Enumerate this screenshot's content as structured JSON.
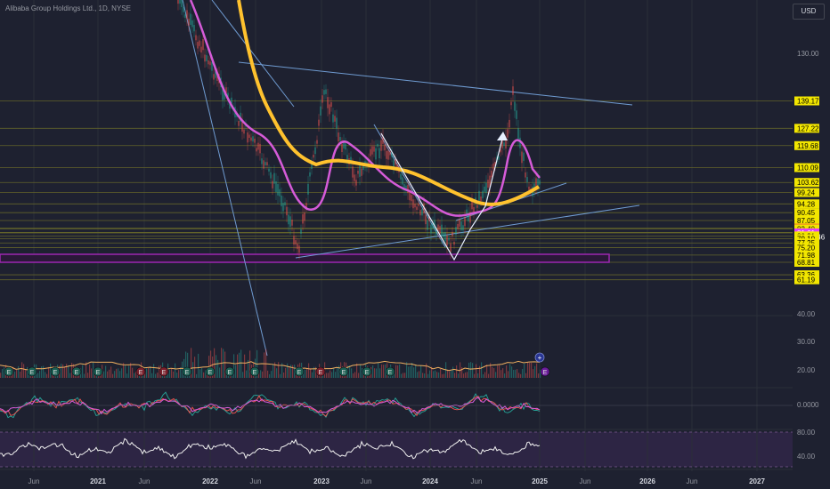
{
  "header": {
    "title": "Alibaba Group Holdings Ltd., 1D, NYSE",
    "currency": "USD"
  },
  "colors": {
    "background": "#1e2130",
    "price_tag_yellow": "#f2e600",
    "price_tag_red": "#f23645",
    "price_tag_magenta": "#e040fb",
    "ma_slow": "#ffc22e",
    "ma_fast": "#d55bd8",
    "trendline": "#6f9bd1",
    "support_zone": "#9c27b0",
    "hline": "#6a6a2a"
  },
  "price_axis": {
    "plain_labels": [
      "130.00",
      "40.00"
    ],
    "tags": [
      {
        "text": "139.17",
        "kind": "yellow"
      },
      {
        "text": "127.22",
        "kind": "yellow"
      },
      {
        "text": "119.68",
        "kind": "yellow"
      },
      {
        "text": "110.09",
        "kind": "yellow"
      },
      {
        "text": "103.62",
        "kind": "yellow"
      },
      {
        "text": "99.24",
        "kind": "yellow"
      },
      {
        "text": "94.28",
        "kind": "yellow"
      },
      {
        "text": "90.45",
        "kind": "yellow"
      },
      {
        "text": "87.05",
        "kind": "yellow"
      },
      {
        "text": "83.66",
        "kind": "red",
        "sub": "01:41:46"
      },
      {
        "text": "83.40",
        "kind": "yellow"
      },
      {
        "text": "81.82",
        "kind": "yellow"
      },
      {
        "text": "81.61",
        "kind": "magenta"
      },
      {
        "text": "80.31",
        "kind": "yellow"
      },
      {
        "text": "79.10",
        "kind": "yellow"
      },
      {
        "text": "77.25",
        "kind": "yellow"
      },
      {
        "text": "75.20",
        "kind": "yellow"
      },
      {
        "text": "71.98",
        "kind": "yellow"
      },
      {
        "text": "68.81",
        "kind": "yellow"
      },
      {
        "text": "63.36",
        "kind": "yellow"
      },
      {
        "text": "61.19",
        "kind": "yellow"
      }
    ]
  },
  "volume_axis": [
    "30.00",
    "20.00"
  ],
  "oscillator_axis": [
    "0.0000"
  ],
  "rsi_axis": [
    "80.00",
    "40.00"
  ],
  "time_axis": [
    {
      "text": "Jun",
      "year": false
    },
    {
      "text": "2021",
      "year": true
    },
    {
      "text": "Jun",
      "year": false
    },
    {
      "text": "2022",
      "year": true
    },
    {
      "text": "Jun",
      "year": false
    },
    {
      "text": "2023",
      "year": true
    },
    {
      "text": "Jun",
      "year": false
    },
    {
      "text": "2024",
      "year": true
    },
    {
      "text": "Jun",
      "year": false
    },
    {
      "text": "2025",
      "year": true
    },
    {
      "text": "Jun",
      "year": false
    },
    {
      "text": "2026",
      "year": true
    },
    {
      "text": "Jun",
      "year": false
    },
    {
      "text": "2027",
      "year": true
    }
  ],
  "earnings_markers": [
    "E",
    "E",
    "E",
    "E",
    "E",
    "E",
    "E",
    "E",
    "E",
    "E",
    "E",
    "E",
    "E",
    "E",
    "E",
    "E",
    "E"
  ],
  "earnings_kinds": [
    "g",
    "g",
    "g",
    "g",
    "g",
    "r",
    "r",
    "g",
    "g",
    "g",
    "g",
    "g",
    "r",
    "g",
    "g",
    "g",
    "p"
  ]
}
